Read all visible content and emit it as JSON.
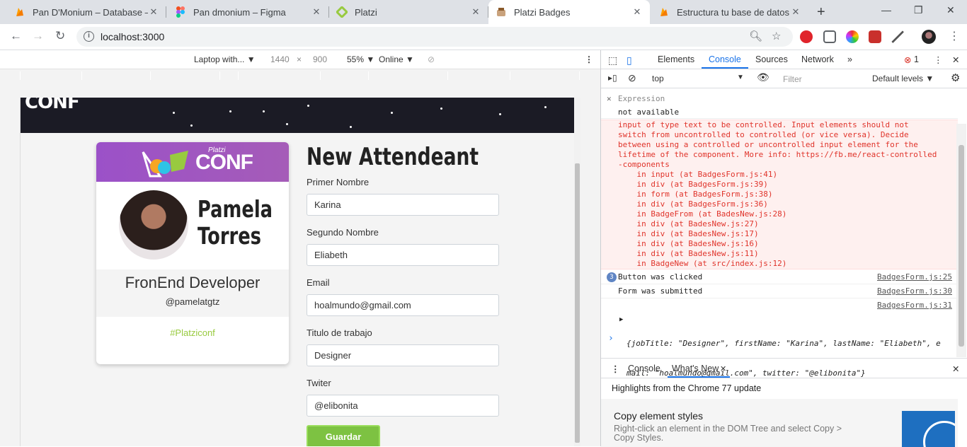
{
  "browser": {
    "tabs": [
      {
        "title": "Pan D'Monium – Database – Fi",
        "close": "✕",
        "icon": "firebase-icon",
        "color": "#f6a623"
      },
      {
        "title": "Pan dmonium – Figma",
        "close": "✕",
        "icon": "figma-icon",
        "color": "#f24e1e"
      },
      {
        "title": "Platzi",
        "close": "✕",
        "icon": "platzi-icon",
        "color": "#98ca3f"
      },
      {
        "title": "Platzi Badges",
        "close": "✕",
        "icon": "react-icon",
        "color": "#61dafb"
      },
      {
        "title": "Estructura tu base de datos |",
        "close": "✕",
        "icon": "firebase-icon",
        "color": "#f6a623"
      }
    ],
    "new_tab": "+",
    "controls": {
      "minimize": "—",
      "maximize": "❐",
      "close": "✕"
    },
    "url": "localhost:3000"
  },
  "device_toolbar": {
    "device": "Laptop with... ▼",
    "width": "1440",
    "times": "×",
    "height": "900",
    "zoom": "55% ▼",
    "network": "Online ▼"
  },
  "badge": {
    "logo": "CONF",
    "brand": "Platzi",
    "first_name": "Pamela",
    "last_name": "Torres",
    "job_title": "FronEnd Developer",
    "twitter": "@pamelatgtz",
    "hashtag": "#Platziconf"
  },
  "form": {
    "title": "New Attendeant",
    "fields": [
      {
        "label": "Primer Nombre",
        "value": "Karina"
      },
      {
        "label": "Segundo Nombre",
        "value": "Eliabeth"
      },
      {
        "label": "Email",
        "value": "hoalmundo@gmail.com"
      },
      {
        "label": "Titulo de trabajo",
        "value": "Designer"
      },
      {
        "label": "Twiter",
        "value": "@elibonita"
      }
    ],
    "submit": "Guardar"
  },
  "devtools": {
    "tabs": [
      "Elements",
      "Console",
      "Sources",
      "Network",
      "»"
    ],
    "error_count": "1",
    "context": "top",
    "filter_placeholder": "Filter",
    "levels": "Default levels ▼",
    "expression_label": "Expression",
    "expression_value": "not available",
    "error_lines": [
      "input of type text to be controlled. Input elements should not",
      "switch from uncontrolled to controlled (or vice versa). Decide",
      "between using a controlled or uncontrolled input element for the",
      "lifetime of the component. More info: https://fb.me/react-controlled",
      "-components",
      "    in input (at BadgesForm.js:41)",
      "    in div (at BadgesForm.js:39)",
      "    in form (at BadgesForm.js:38)",
      "    in div (at BadgesForm.js:36)",
      "    in BadgeFrom (at BadesNew.js:28)",
      "    in div (at BadesNew.js:27)",
      "    in div (at BadesNew.js:17)",
      "    in div (at BadesNew.js:16)",
      "    in div (at BadesNew.js:11)",
      "    in BadgeNew (at src/index.js:12)"
    ],
    "logs": [
      {
        "count": "3",
        "text": "Button was clicked",
        "source": "BadgesForm.js:25"
      },
      {
        "count": "",
        "text": "Form was submitted",
        "source": "BadgesForm.js:30"
      },
      {
        "count": "",
        "text": "",
        "source": "BadgesForm.js:31"
      }
    ],
    "object_line1": "{jobTitle: \"Designer\", firstName: \"Karina\", lastName: \"Eliabeth\", e",
    "object_line2": "mail: \"hoalmundo@gmail.com\", twitter: \"@elibonita\"}",
    "drawer_tabs": [
      "Console",
      "What's New"
    ],
    "drawer_heading": "Highlights from the Chrome 77 update",
    "whats_new_title": "Copy element styles",
    "whats_new_text": "Right-click an element in the DOM Tree and select Copy > Copy Styles."
  }
}
